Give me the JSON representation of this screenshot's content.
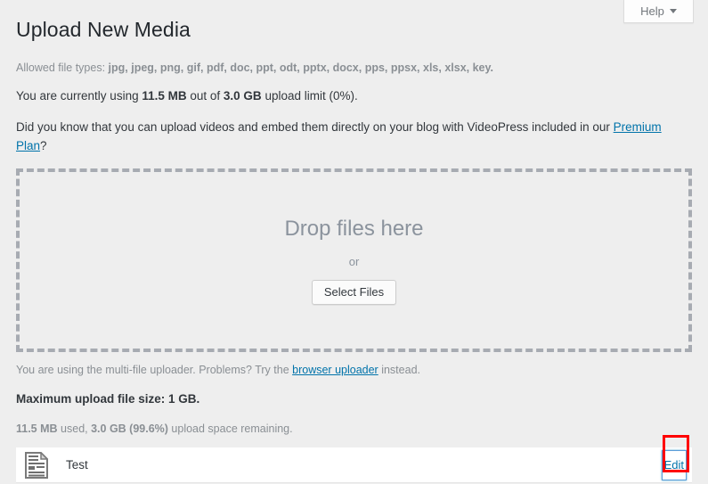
{
  "header": {
    "help_label": "Help",
    "help_icon": "chevron-down-icon"
  },
  "page": {
    "title": "Upload New Media",
    "allowed_types_label": "Allowed file types:",
    "allowed_types_value": "jpg, jpeg, png, gif, pdf, doc, ppt, odt, pptx, docx, pps, ppsx, xls, xlsx, key.",
    "usage": {
      "prefix": "You are currently using ",
      "used": "11.5 MB",
      "middle": " out of ",
      "limit": "3.0 GB",
      "suffix": " upload limit (0%)."
    },
    "videopress": {
      "text_before": "Did you know that you can upload videos and embed them directly on your blog with VideoPress included in our ",
      "link_text": "Premium Plan",
      "text_after": "?"
    }
  },
  "dropzone": {
    "title": "Drop files here",
    "or_label": "or",
    "select_button": "Select Files"
  },
  "footer": {
    "uploader_note_before": "You are using the multi-file uploader. Problems? Try the ",
    "uploader_link": "browser uploader",
    "uploader_note_after": " instead.",
    "max_size": "Maximum upload file size: 1 GB.",
    "space": {
      "used": "11.5 MB",
      "used_suffix": " used, ",
      "remaining": "3.0 GB (99.6%)",
      "remaining_suffix": " upload space remaining."
    }
  },
  "media_item": {
    "icon": "document-file-icon",
    "name": "Test",
    "edit_label": "Edit"
  },
  "colors": {
    "page_background": "#eeeeee",
    "link": "#0073aa",
    "dropzone_border": "#a7abb2",
    "dropzone_text": "#8b939d",
    "annotation": "#ff0000",
    "focus_ring": "#5b9dd9"
  }
}
